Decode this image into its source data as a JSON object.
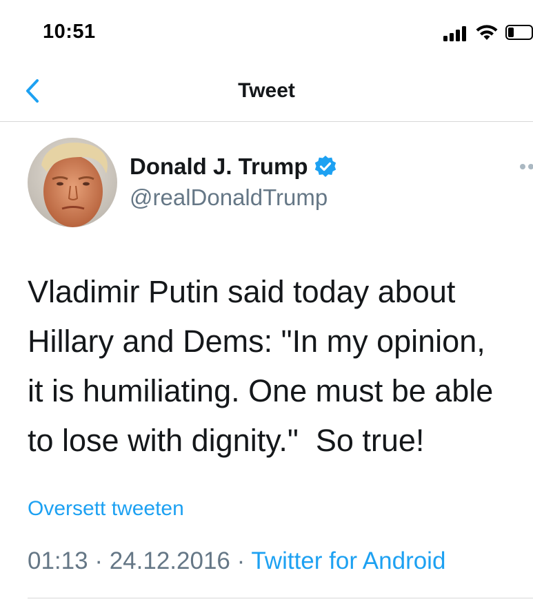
{
  "status_bar": {
    "time": "10:51",
    "icons": [
      "signal-icon",
      "wifi-icon",
      "battery-icon"
    ]
  },
  "nav": {
    "title": "Tweet",
    "back_icon": "chevron-left-icon",
    "accent_color": "#1da1f2"
  },
  "tweet": {
    "user_name": "Donald J. Trump",
    "handle": "@realDonaldTrump",
    "verified_icon": "verified-badge-icon",
    "more_icon": "more-dots-icon",
    "text": "Vladimir Putin said today about\nHillary and Dems: \"In my opinion,\nit is humiliating. One must be able\nto lose with dignity.\"  So true!",
    "translate_label": "Oversett tweeten",
    "time": "01:13",
    "separator": " · ",
    "date": "24.12.2016",
    "source": "Twitter for Android"
  },
  "colors": {
    "text": "#14171a",
    "secondary": "#657786",
    "link": "#1da1f2",
    "divider": "#d7d7d7"
  }
}
